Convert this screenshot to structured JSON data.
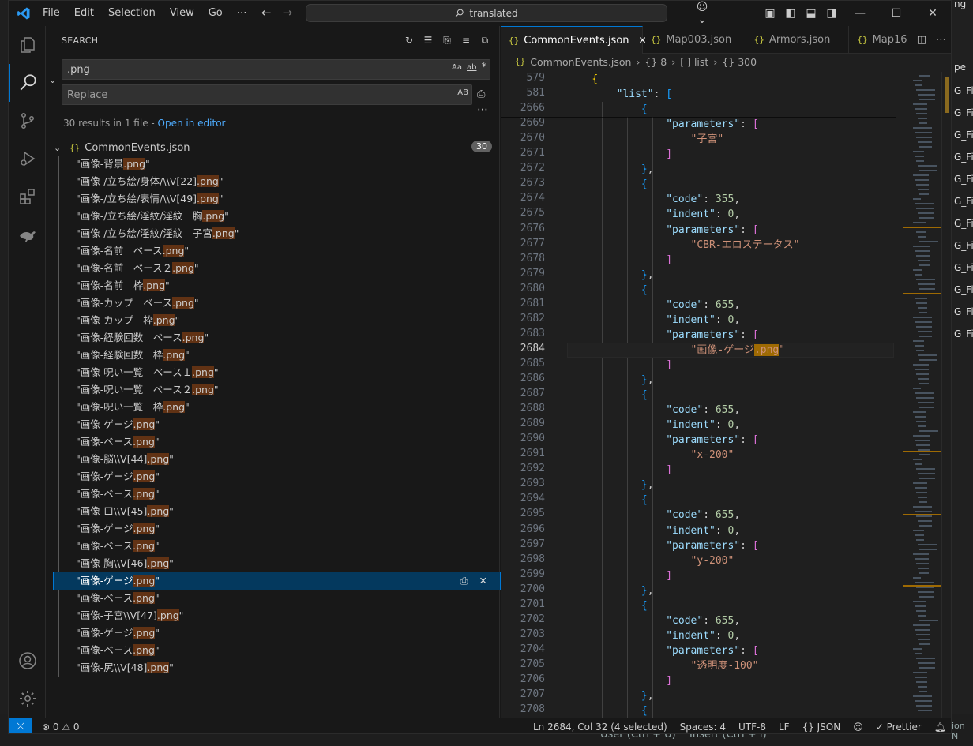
{
  "titlebar": {
    "menu": [
      "File",
      "Edit",
      "Selection",
      "View",
      "Go",
      "⋯"
    ],
    "command_center": "translated"
  },
  "sidebar": {
    "title": "SEARCH",
    "search_value": ".png",
    "search_opts": [
      "Aa",
      "ab",
      "*"
    ],
    "replace_placeholder": "Replace",
    "replace_opt": "AB",
    "results_summary": "30 results in 1 file - ",
    "open_in_editor": "Open in editor",
    "file_name": "CommonEvents.json",
    "file_count": "30",
    "results": [
      {
        "pre": "\"画像-背景",
        "post": "\""
      },
      {
        "pre": "\"画像-/立ち絵/身体/\\\\V[22]",
        "post": "\""
      },
      {
        "pre": "\"画像-/立ち絵/表情/\\\\V[49]",
        "post": "\""
      },
      {
        "pre": "\"画像-/立ち絵/淫紋/淫紋　胸",
        "post": "\""
      },
      {
        "pre": "\"画像-/立ち絵/淫紋/淫紋　子宮",
        "post": "\""
      },
      {
        "pre": "\"画像-名前　ベース",
        "post": "\""
      },
      {
        "pre": "\"画像-名前　ベース２",
        "post": "\""
      },
      {
        "pre": "\"画像-名前　枠",
        "post": "\""
      },
      {
        "pre": "\"画像-カップ　ベース",
        "post": "\""
      },
      {
        "pre": "\"画像-カップ　枠",
        "post": "\""
      },
      {
        "pre": "\"画像-経験回数　ベース",
        "post": "\""
      },
      {
        "pre": "\"画像-経験回数　枠",
        "post": "\""
      },
      {
        "pre": "\"画像-呪い一覧　ベース１",
        "post": "\""
      },
      {
        "pre": "\"画像-呪い一覧　ベース２",
        "post": "\""
      },
      {
        "pre": "\"画像-呪い一覧　枠",
        "post": "\""
      },
      {
        "pre": "\"画像-ゲージ",
        "post": "\""
      },
      {
        "pre": "\"画像-ベース",
        "post": "\""
      },
      {
        "pre": "\"画像-脳\\\\V[44]",
        "post": "\""
      },
      {
        "pre": "\"画像-ゲージ",
        "post": "\""
      },
      {
        "pre": "\"画像-ベース",
        "post": "\""
      },
      {
        "pre": "\"画像-口\\\\V[45]",
        "post": "\""
      },
      {
        "pre": "\"画像-ゲージ",
        "post": "\""
      },
      {
        "pre": "\"画像-ベース",
        "post": "\""
      },
      {
        "pre": "\"画像-胸\\\\V[46]",
        "post": "\""
      },
      {
        "pre": "\"画像-ゲージ",
        "post": "\"",
        "selected": true
      },
      {
        "pre": "\"画像-ベース",
        "post": "\""
      },
      {
        "pre": "\"画像-子宮\\\\V[47]",
        "post": "\""
      },
      {
        "pre": "\"画像-ゲージ",
        "post": "\""
      },
      {
        "pre": "\"画像-ベース",
        "post": "\""
      },
      {
        "pre": "\"画像-尻\\\\V[48]",
        "post": "\""
      }
    ],
    "match": ".png"
  },
  "editor": {
    "tabs": [
      {
        "label": "CommonEvents.json",
        "active": true
      },
      {
        "label": "Map003.json"
      },
      {
        "label": "Armors.json"
      },
      {
        "label": "Map16"
      }
    ],
    "breadcrumb": [
      "CommonEvents.json",
      "{} 8",
      "[ ] list",
      "{} 300"
    ],
    "lines": [
      {
        "n": "579",
        "t": "    {",
        "cls": "b1"
      },
      {
        "n": "581",
        "t": "        \"list\": [",
        "kind": "key-arr"
      },
      {
        "n": "2666",
        "t": "            {",
        "cls": "b3"
      },
      {
        "n": "2669",
        "t": "                \"parameters\": [",
        "kind": "key-arr"
      },
      {
        "n": "2670",
        "t": "                    \"子宮\"",
        "kind": "str"
      },
      {
        "n": "2671",
        "t": "                ]",
        "cls": "b2"
      },
      {
        "n": "2672",
        "t": "            },",
        "cls": "b3"
      },
      {
        "n": "2673",
        "t": "            {",
        "cls": "b3"
      },
      {
        "n": "2674",
        "t": "                \"code\": 355,",
        "kind": "key-num"
      },
      {
        "n": "2675",
        "t": "                \"indent\": 0,",
        "kind": "key-num"
      },
      {
        "n": "2676",
        "t": "                \"parameters\": [",
        "kind": "key-arr"
      },
      {
        "n": "2677",
        "t": "                    \"CBR-エロステータス\"",
        "kind": "str"
      },
      {
        "n": "2678",
        "t": "                ]",
        "cls": "b2"
      },
      {
        "n": "2679",
        "t": "            },",
        "cls": "b3"
      },
      {
        "n": "2680",
        "t": "            {",
        "cls": "b3"
      },
      {
        "n": "2681",
        "t": "                \"code\": 655,",
        "kind": "key-num"
      },
      {
        "n": "2682",
        "t": "                \"indent\": 0,",
        "kind": "key-num"
      },
      {
        "n": "2683",
        "t": "                \"parameters\": [",
        "kind": "key-arr"
      },
      {
        "n": "2684",
        "t": "                    \"画像-ゲージ.png\"",
        "kind": "str-hl",
        "cur": true
      },
      {
        "n": "2685",
        "t": "                ]",
        "cls": "b2"
      },
      {
        "n": "2686",
        "t": "            },",
        "cls": "b3"
      },
      {
        "n": "2687",
        "t": "            {",
        "cls": "b3"
      },
      {
        "n": "2688",
        "t": "                \"code\": 655,",
        "kind": "key-num"
      },
      {
        "n": "2689",
        "t": "                \"indent\": 0,",
        "kind": "key-num"
      },
      {
        "n": "2690",
        "t": "                \"parameters\": [",
        "kind": "key-arr"
      },
      {
        "n": "2691",
        "t": "                    \"x-200\"",
        "kind": "str"
      },
      {
        "n": "2692",
        "t": "                ]",
        "cls": "b2"
      },
      {
        "n": "2693",
        "t": "            },",
        "cls": "b3"
      },
      {
        "n": "2694",
        "t": "            {",
        "cls": "b3"
      },
      {
        "n": "2695",
        "t": "                \"code\": 655,",
        "kind": "key-num"
      },
      {
        "n": "2696",
        "t": "                \"indent\": 0,",
        "kind": "key-num"
      },
      {
        "n": "2697",
        "t": "                \"parameters\": [",
        "kind": "key-arr"
      },
      {
        "n": "2698",
        "t": "                    \"y-200\"",
        "kind": "str"
      },
      {
        "n": "2699",
        "t": "                ]",
        "cls": "b2"
      },
      {
        "n": "2700",
        "t": "            },",
        "cls": "b3"
      },
      {
        "n": "2701",
        "t": "            {",
        "cls": "b3"
      },
      {
        "n": "2702",
        "t": "                \"code\": 655,",
        "kind": "key-num"
      },
      {
        "n": "2703",
        "t": "                \"indent\": 0,",
        "kind": "key-num"
      },
      {
        "n": "2704",
        "t": "                \"parameters\": [",
        "kind": "key-arr"
      },
      {
        "n": "2705",
        "t": "                    \"透明度-100\"",
        "kind": "str"
      },
      {
        "n": "2706",
        "t": "                ]",
        "cls": "b2"
      },
      {
        "n": "2707",
        "t": "            },",
        "cls": "b3"
      },
      {
        "n": "2708",
        "t": "            {",
        "cls": "b3"
      }
    ]
  },
  "status": {
    "problems": "⊗ 0 ⚠ 0",
    "position": "Ln 2684, Col 32 (4 selected)",
    "spaces": "Spaces: 4",
    "encoding": "UTF-8",
    "eol": "LF",
    "language": "{} JSON",
    "prettier": "✓ Prettier"
  },
  "background_app": {
    "rows": [
      "G_Fi",
      "G_Fi",
      "G_Fi",
      "G_Fi",
      "G_Fi",
      "G_Fi",
      "G_Fi",
      "G_Fi",
      "G_Fi",
      "G_Fi",
      "G_Fi",
      "G_Fi"
    ],
    "top_text": "ng",
    "pe_text": "pe",
    "bottom_user": "User (Ctrl + U)",
    "bottom_insert": "Insert (Ctrl + I)",
    "bottom_right": "ion N"
  },
  "colors": {
    "accent": "#0078d4",
    "match_bg": "#613214",
    "selection": "#04395e"
  }
}
